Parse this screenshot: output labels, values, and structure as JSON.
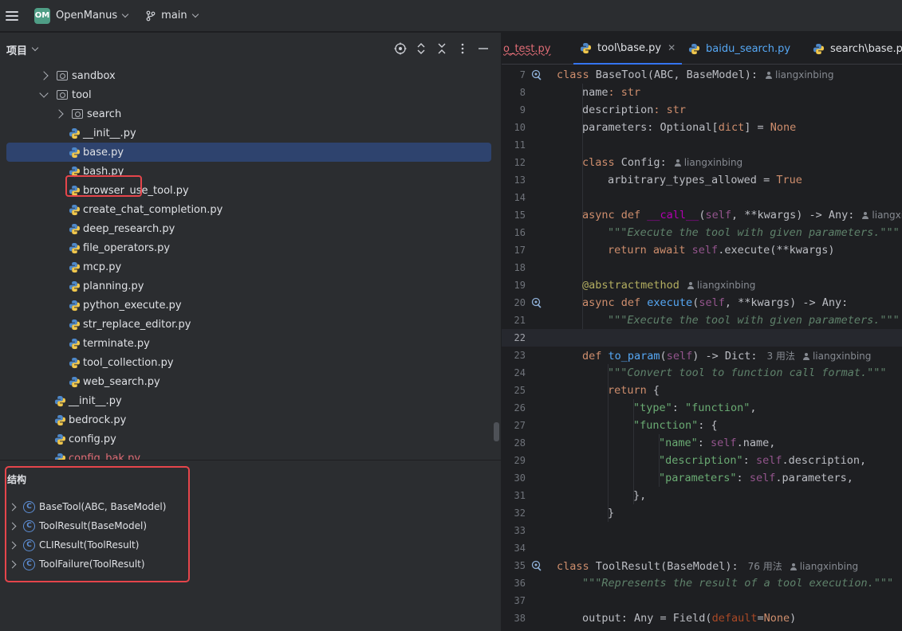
{
  "titlebar": {
    "project_badge": "OM",
    "project_name": "OpenManus",
    "branch": "main"
  },
  "project_panel": {
    "title": "项目",
    "tree": [
      {
        "label": "sandbox",
        "type": "folder",
        "expanded": false,
        "depth": 1
      },
      {
        "label": "tool",
        "type": "folder",
        "expanded": true,
        "depth": 1
      },
      {
        "label": "search",
        "type": "folder",
        "expanded": false,
        "depth": 2
      },
      {
        "label": "__init__.py",
        "type": "py",
        "depth": 3
      },
      {
        "label": "base.py",
        "type": "py",
        "depth": 3,
        "selected": true
      },
      {
        "label": "bash.py",
        "type": "py",
        "depth": 3
      },
      {
        "label": "browser_use_tool.py",
        "type": "py",
        "depth": 3
      },
      {
        "label": "create_chat_completion.py",
        "type": "py",
        "depth": 3
      },
      {
        "label": "deep_research.py",
        "type": "py",
        "depth": 3
      },
      {
        "label": "file_operators.py",
        "type": "py",
        "depth": 3
      },
      {
        "label": "mcp.py",
        "type": "py",
        "depth": 3
      },
      {
        "label": "planning.py",
        "type": "py",
        "depth": 3
      },
      {
        "label": "python_execute.py",
        "type": "py",
        "depth": 3
      },
      {
        "label": "str_replace_editor.py",
        "type": "py",
        "depth": 3
      },
      {
        "label": "terminate.py",
        "type": "py",
        "depth": 3
      },
      {
        "label": "tool_collection.py",
        "type": "py",
        "depth": 3
      },
      {
        "label": "web_search.py",
        "type": "py",
        "depth": 3
      },
      {
        "label": "__init__.py",
        "type": "py",
        "depth": 2
      },
      {
        "label": "bedrock.py",
        "type": "py",
        "depth": 2
      },
      {
        "label": "config.py",
        "type": "py",
        "depth": 2
      },
      {
        "label": "config_bak.py",
        "type": "py",
        "depth": 2
      }
    ]
  },
  "structure_panel": {
    "title": "结构",
    "items": [
      "BaseTool(ABC, BaseModel)",
      "ToolResult(BaseModel)",
      "CLIResult(ToolResult)",
      "ToolFailure(ToolResult)"
    ]
  },
  "tabs": [
    {
      "label": "o_test.py",
      "color": "#e06c75"
    },
    {
      "label": "tool\\base.py",
      "active": true
    },
    {
      "label": "baidu_search.py",
      "color": "#56a8f5"
    },
    {
      "label": "search\\base.py"
    }
  ],
  "author": "liangxinbing",
  "usages_3": "3 用法",
  "usages_76": "76 用法",
  "line_numbers": [
    "7",
    "8",
    "9",
    "10",
    "11",
    "12",
    "13",
    "14",
    "15",
    "16",
    "17",
    "18",
    "19",
    "20",
    "21",
    "22",
    "23",
    "24",
    "25",
    "26",
    "27",
    "28",
    "29",
    "30",
    "31",
    "32",
    "33",
    "34",
    "35",
    "36",
    "37",
    "38"
  ],
  "code": {
    "l7": [
      "class ",
      "BaseTool",
      "(ABC, BaseModel):"
    ],
    "l8": [
      "name",
      ": str"
    ],
    "l9": [
      "description",
      ": str"
    ],
    "l10": [
      "parameters",
      ": Optional[",
      "dict",
      "] = ",
      "None"
    ],
    "l12": [
      "class ",
      "Config",
      ":"
    ],
    "l13": [
      "arbitrary_types_allowed",
      " = ",
      "True"
    ],
    "l15": [
      "async def ",
      "__call__",
      "(",
      "self",
      ", **kwargs) -> Any:"
    ],
    "l16": "\"\"\"Execute the tool with given parameters.\"\"\"",
    "l17": [
      "return await ",
      "self",
      ".execute(**kwargs)"
    ],
    "l19": "@abstractmethod",
    "l20": [
      "async def ",
      "execute",
      "(",
      "self",
      ", **kwargs) -> Any:"
    ],
    "l21": "\"\"\"Execute the tool with given parameters.\"\"\"",
    "l23": [
      "def ",
      "to_param",
      "(",
      "self",
      ") -> Dict:"
    ],
    "l24": "\"\"\"Convert tool to function call format.\"\"\"",
    "l25": [
      "return ",
      "{"
    ],
    "l26": [
      "\"type\"",
      ": ",
      "\"function\"",
      ","
    ],
    "l27": [
      "\"function\"",
      ": {"
    ],
    "l28": [
      "\"name\"",
      ": ",
      "self",
      ".name,"
    ],
    "l29": [
      "\"description\"",
      ": ",
      "self",
      ".description,"
    ],
    "l30": [
      "\"parameters\"",
      ": ",
      "self",
      ".parameters,"
    ],
    "l31": "},",
    "l32": "}",
    "l35": [
      "class ",
      "ToolResult",
      "(BaseModel):"
    ],
    "l36": "\"\"\"Represents the result of a tool execution.\"\"\"",
    "l38": [
      "output: Any = Field(",
      "default",
      "=",
      "None",
      ")"
    ]
  },
  "colors": {
    "keyword": "#cf8e6d",
    "function": "#56a8f5",
    "string": "#6aab73",
    "self": "#94558d",
    "docstring": "#5f826b",
    "selection": "#2e436e",
    "highlight_box": "#e5454b"
  }
}
